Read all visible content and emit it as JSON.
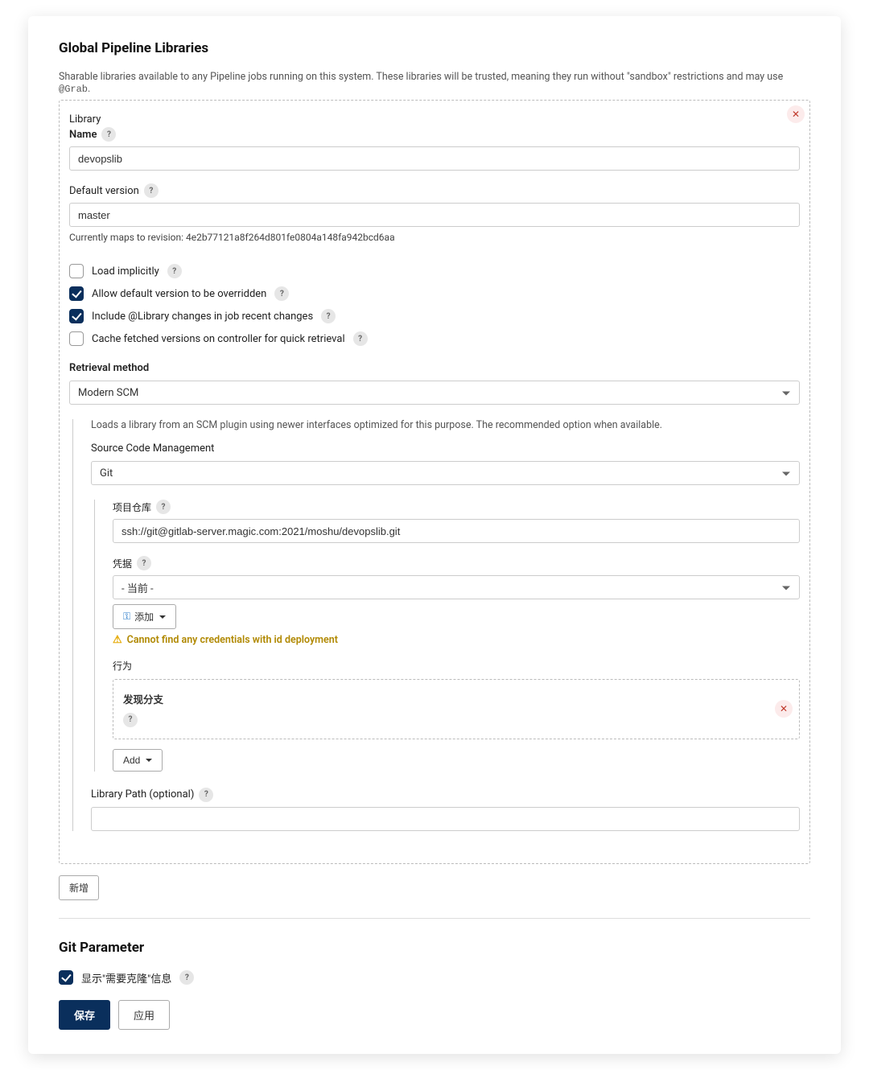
{
  "header": {
    "title": "Global Pipeline Libraries",
    "description_prefix": "Sharable libraries available to any Pipeline jobs running on this system. These libraries will be trusted, meaning they run without \"sandbox\" restrictions and may use ",
    "description_code": "@Grab",
    "description_suffix": "."
  },
  "library": {
    "section_label": "Library",
    "name_label": "Name",
    "name_value": "devopslib",
    "default_version_label": "Default version",
    "default_version_value": "master",
    "revision_prefix": "Currently maps to revision: ",
    "revision_hash": "4e2b77121a8f264d801fe0804a148fa942bcd6aa",
    "checkboxes": {
      "load_implicitly": {
        "label": "Load implicitly",
        "checked": false
      },
      "allow_override": {
        "label": "Allow default version to be overridden",
        "checked": true
      },
      "include_changes": {
        "label": "Include @Library changes in job recent changes",
        "checked": true
      },
      "cache_fetched": {
        "label": "Cache fetched versions on controller for quick retrieval",
        "checked": false
      }
    },
    "retrieval": {
      "label": "Retrieval method",
      "selected": "Modern SCM",
      "description": "Loads a library from an SCM plugin using newer interfaces optimized for this purpose. The recommended option when available.",
      "scm_label": "Source Code Management",
      "scm_selected": "Git",
      "repo_label": "项目仓库",
      "repo_value": "ssh://git@gitlab-server.magic.com:2021/moshu/devopslib.git",
      "credentials_label": "凭据",
      "credentials_selected": "- 当前 -",
      "add_credentials_label": "添加",
      "credentials_warning": "Cannot find any credentials with id deployment",
      "behavior_label": "行为",
      "behavior_item": "发现分支",
      "add_behavior_label": "Add",
      "library_path_label": "Library Path (optional)",
      "library_path_value": ""
    }
  },
  "add_library_button": "新增",
  "git_parameter": {
    "title": "Git Parameter",
    "show_clone_label": "显示\"需要克隆\"信息",
    "show_clone_checked": true
  },
  "footer": {
    "save": "保存",
    "apply": "应用"
  }
}
